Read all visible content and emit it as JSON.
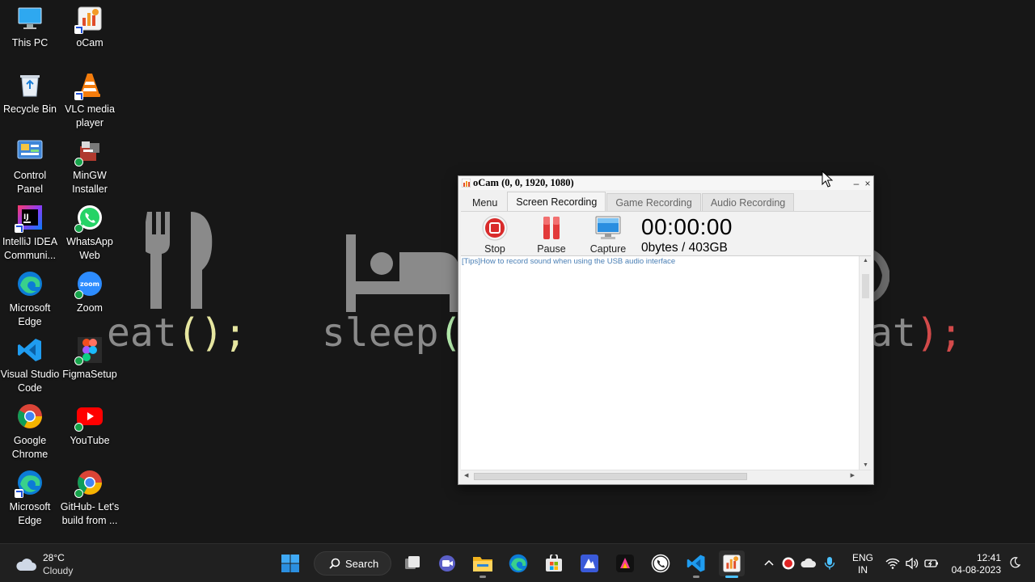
{
  "desktop": {
    "icons": [
      {
        "label": "This PC",
        "icon": "this-pc-icon"
      },
      {
        "label": "oCam",
        "icon": "ocam-icon"
      },
      {
        "label": "Recycle Bin",
        "icon": "recycle-bin-icon"
      },
      {
        "label": "VLC media player",
        "icon": "vlc-icon"
      },
      {
        "label": "Control Panel",
        "icon": "control-panel-icon"
      },
      {
        "label": "MinGW Installer",
        "icon": "mingw-icon"
      },
      {
        "label": "IntelliJ IDEA Communi...",
        "icon": "intellij-icon"
      },
      {
        "label": "WhatsApp Web",
        "icon": "whatsapp-icon"
      },
      {
        "label": "Microsoft Edge",
        "icon": "edge-icon"
      },
      {
        "label": "Zoom",
        "icon": "zoom-icon"
      },
      {
        "label": "Visual Studio Code",
        "icon": "vscode-icon"
      },
      {
        "label": "FigmaSetup",
        "icon": "figma-icon"
      },
      {
        "label": "Google Chrome",
        "icon": "chrome-icon"
      },
      {
        "label": "YouTube",
        "icon": "youtube-icon"
      },
      {
        "label": "Microsoft Edge",
        "icon": "edge-icon"
      },
      {
        "label": "GitHub- Let's build from ...",
        "icon": "chrome-icon"
      }
    ]
  },
  "wallpaper": {
    "word1": "eat",
    "word2": "sleep",
    "word3": "at",
    "punct": "();",
    "open_paren": "(",
    "close_semicolon": ");"
  },
  "ocam": {
    "title": "oCam (0, 0, 1920, 1080)",
    "minimize": "–",
    "close": "×",
    "tabs": [
      "Menu",
      "Screen Recording",
      "Game Recording",
      "Audio Recording"
    ],
    "active_tab": "Screen Recording",
    "toolbar": {
      "stop": "Stop",
      "pause": "Pause",
      "capture": "Capture"
    },
    "timer": "00:00:00",
    "storage": "0bytes / 403GB",
    "tips": "[Tips]How to record sound when using the USB audio interface"
  },
  "taskbar": {
    "weather": {
      "temp": "28°C",
      "condition": "Cloudy"
    },
    "search_label": "Search",
    "apps": [
      "start-icon",
      "search-icon",
      "task-view-icon",
      "meet-icon",
      "file-explorer-icon",
      "edge-icon",
      "store-icon",
      "app-icon",
      "adobe-icon",
      "whatsapp-icon",
      "vscode-icon",
      "ocam-icon"
    ],
    "language": {
      "line1": "ENG",
      "line2": "IN"
    },
    "time": "12:41",
    "date": "04-08-2023"
  },
  "colors": {
    "accent": "#4cc2ff",
    "stop_red": "#d92b2b",
    "tips_blue": "#4a7fb5",
    "taskbar_bg": "#202020"
  }
}
